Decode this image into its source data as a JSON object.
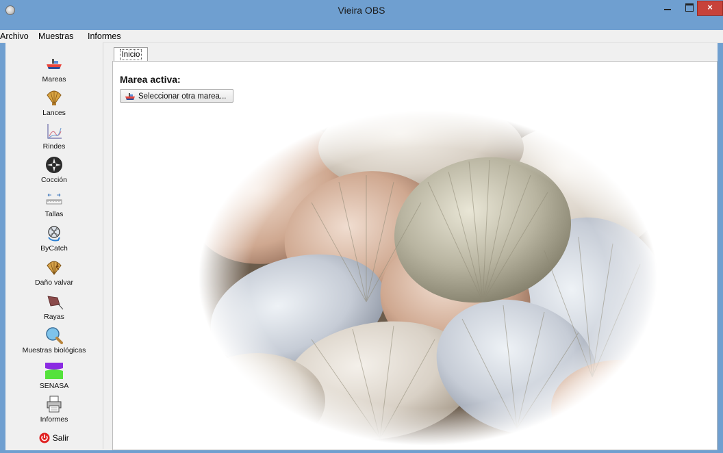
{
  "window": {
    "title": "Vieira OBS",
    "close_glyph": "×"
  },
  "menu": {
    "items": [
      {
        "label": "Archivo"
      },
      {
        "label": "Muestras"
      },
      {
        "label": "Informes"
      }
    ]
  },
  "sidebar": {
    "items": [
      {
        "label": "Mareas",
        "icon": "boat-icon"
      },
      {
        "label": "Lances",
        "icon": "scallop-shell-icon"
      },
      {
        "label": "Rindes",
        "icon": "line-chart-icon"
      },
      {
        "label": "Cocción",
        "icon": "aperture-icon"
      },
      {
        "label": "Tallas",
        "icon": "ruler-icon"
      },
      {
        "label": "ByCatch",
        "icon": "bycatch-icon"
      },
      {
        "label": "Daño valvar",
        "icon": "damaged-shell-icon"
      },
      {
        "label": "Rayas",
        "icon": "ray-fish-icon"
      },
      {
        "label": "Muestras biológicas",
        "icon": "magnifier-icon"
      },
      {
        "label": "SENASA",
        "icon": "senasa-logo-icon"
      },
      {
        "label": "Informes",
        "icon": "printer-icon"
      }
    ],
    "exit": {
      "label": "Salir",
      "icon": "power-icon"
    }
  },
  "tabs": [
    {
      "label": "Inicio",
      "active": true
    }
  ],
  "main": {
    "active_marea_label": "Marea activa:",
    "select_button_label": "Seleccionar otra marea..."
  },
  "colors": {
    "titlebar": "#6f9fd0",
    "close_button": "#c7423a",
    "senasa_purple": "#8a2be2",
    "senasa_green": "#55e23c",
    "exit_red": "#e02020"
  }
}
